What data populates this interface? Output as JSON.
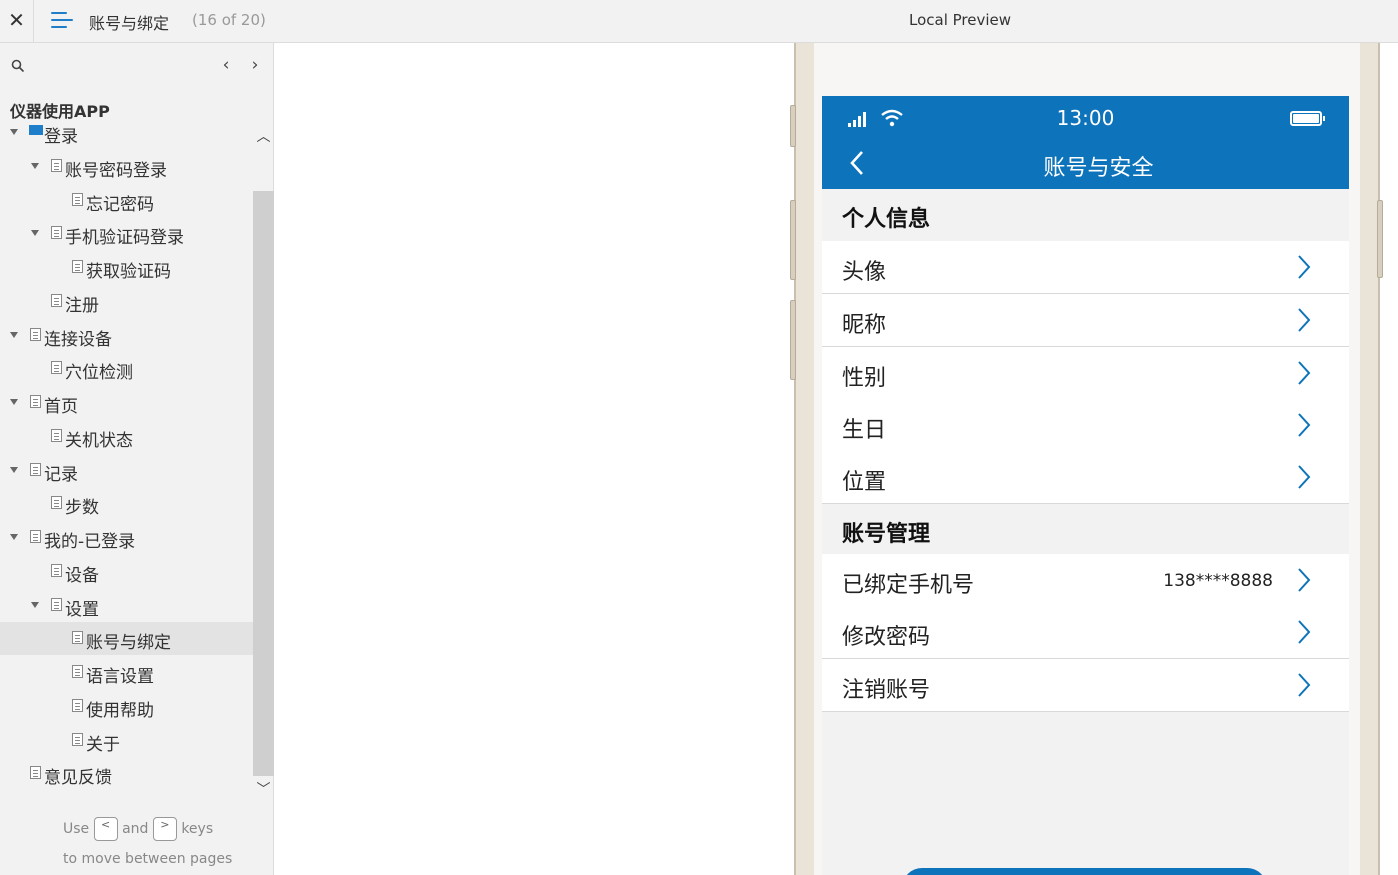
{
  "topbar": {
    "page_title": "账号与绑定",
    "page_count": "(16 of 20)",
    "preview_label": "Local Preview"
  },
  "sidebar": {
    "project_title": "仪器使用APP",
    "items": [
      {
        "label": "登录",
        "level": 0,
        "type": "folder",
        "expanded": true
      },
      {
        "label": "账号密码登录",
        "level": 1,
        "type": "page",
        "expanded": true
      },
      {
        "label": "忘记密码",
        "level": 2,
        "type": "page"
      },
      {
        "label": "手机验证码登录",
        "level": 1,
        "type": "page",
        "expanded": true
      },
      {
        "label": "获取验证码",
        "level": 2,
        "type": "page"
      },
      {
        "label": "注册",
        "level": 1,
        "type": "page"
      },
      {
        "label": "连接设备",
        "level": 0,
        "type": "page",
        "expanded": true
      },
      {
        "label": "穴位检测",
        "level": 1,
        "type": "page"
      },
      {
        "label": "首页",
        "level": 0,
        "type": "page",
        "expanded": true
      },
      {
        "label": "关机状态",
        "level": 1,
        "type": "page"
      },
      {
        "label": "记录",
        "level": 0,
        "type": "page",
        "expanded": true
      },
      {
        "label": "步数",
        "level": 1,
        "type": "page"
      },
      {
        "label": "我的-已登录",
        "level": 0,
        "type": "page",
        "expanded": true
      },
      {
        "label": "设备",
        "level": 1,
        "type": "page"
      },
      {
        "label": "设置",
        "level": 1,
        "type": "page",
        "expanded": true
      },
      {
        "label": "账号与绑定",
        "level": 2,
        "type": "page",
        "active": true
      },
      {
        "label": "语言设置",
        "level": 2,
        "type": "page"
      },
      {
        "label": "使用帮助",
        "level": 2,
        "type": "page"
      },
      {
        "label": "关于",
        "level": 2,
        "type": "page"
      },
      {
        "label": "意见反馈",
        "level": 0,
        "type": "page"
      }
    ],
    "hint": {
      "use": "Use",
      "key_prev": "<",
      "and": "and",
      "key_next": ">",
      "keys": "keys",
      "line2": "to move between pages"
    }
  },
  "phone": {
    "status_time": "13:00",
    "nav_title": "账号与安全",
    "sections": [
      {
        "title": "个人信息",
        "rows": [
          {
            "label": "头像",
            "value": ""
          },
          {
            "label": "昵称",
            "value": ""
          },
          {
            "label": "性别",
            "value": ""
          },
          {
            "label": "生日",
            "value": ""
          },
          {
            "label": "位置",
            "value": ""
          }
        ]
      },
      {
        "title": "账号管理",
        "rows": [
          {
            "label": "已绑定手机号",
            "value": "138****8888"
          },
          {
            "label": "修改密码",
            "value": ""
          },
          {
            "label": "注销账号",
            "value": ""
          }
        ]
      }
    ]
  },
  "colors": {
    "accent": "#0d73ba",
    "sidebar_bg": "#f2f2f2",
    "active_item_bg": "#e3e3e3"
  },
  "icons": [
    "close-icon",
    "menu-icon",
    "search-icon",
    "chevron-left-icon",
    "chevron-right-icon",
    "folder-icon",
    "page-icon",
    "signal-icon",
    "wifi-icon",
    "battery-icon",
    "back-icon"
  ]
}
